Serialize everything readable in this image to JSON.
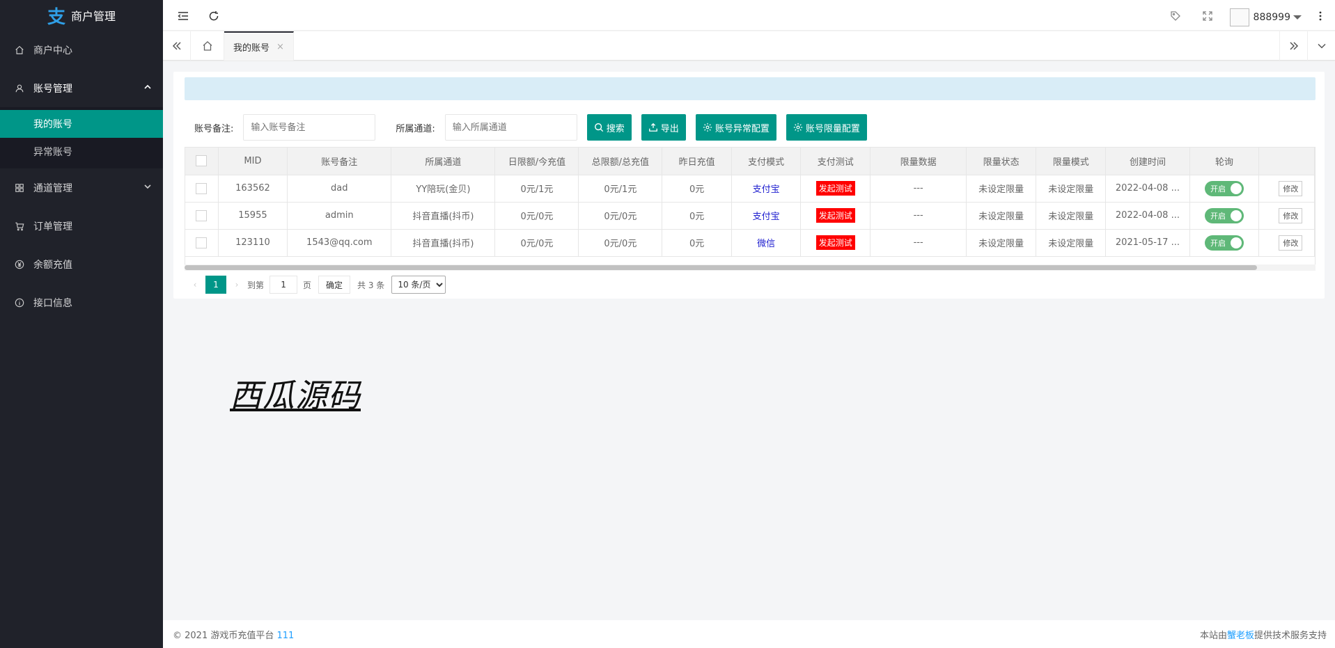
{
  "sidebar": {
    "logo_mark": "支",
    "title": "商户管理",
    "items": [
      {
        "label": "商户中心"
      },
      {
        "label": "账号管理",
        "children": [
          {
            "label": "我的账号"
          },
          {
            "label": "异常账号"
          }
        ]
      },
      {
        "label": "通道管理"
      },
      {
        "label": "订单管理"
      },
      {
        "label": "余额充值"
      },
      {
        "label": "接口信息"
      }
    ]
  },
  "header": {
    "username": "888999"
  },
  "tabs": [
    {
      "label": "我的账号",
      "close": "×"
    }
  ],
  "filter": {
    "remark_label": "账号备注:",
    "remark_placeholder": "输入账号备注",
    "channel_label": "所属通道:",
    "channel_placeholder": "输入所属通道",
    "search_btn": "搜索",
    "export_btn": "导出",
    "abnormal_btn": "账号异常配置",
    "limit_btn": "账号限量配置"
  },
  "table": {
    "columns": [
      "MID",
      "账号备注",
      "所属通道",
      "日限额/今充值",
      "总限额/总充值",
      "昨日充值",
      "支付模式",
      "支付测试",
      "限量数据",
      "限量状态",
      "限量模式",
      "创建时间",
      "轮询",
      ""
    ],
    "rows": [
      {
        "mid": "163562",
        "remark": "dad",
        "channel": "YY陪玩(金贝)",
        "daily": "0元/1元",
        "total": "0元/1元",
        "yesterday": "0元",
        "pay_mode": "支付宝",
        "test": "发起测试",
        "limit_data": "---",
        "limit_status": "未设定限量",
        "limit_mode": "未设定限量",
        "created": "2022-04-08 ...",
        "poll": "开启",
        "edit": "修改"
      },
      {
        "mid": "15955",
        "remark": "admin",
        "channel": "抖音直播(抖币)",
        "daily": "0元/0元",
        "total": "0元/0元",
        "yesterday": "0元",
        "pay_mode": "支付宝",
        "test": "发起测试",
        "limit_data": "---",
        "limit_status": "未设定限量",
        "limit_mode": "未设定限量",
        "created": "2022-04-08 ...",
        "poll": "开启",
        "edit": "修改"
      },
      {
        "mid": "123110",
        "remark": "1543@qq.com",
        "channel": "抖音直播(抖币)",
        "daily": "0元/0元",
        "total": "0元/0元",
        "yesterday": "0元",
        "pay_mode": "微信",
        "test": "发起测试",
        "limit_data": "---",
        "limit_status": "未设定限量",
        "limit_mode": "未设定限量",
        "created": "2021-05-17 ...",
        "poll": "开启",
        "edit": "修改"
      }
    ]
  },
  "pager": {
    "current": "1",
    "goto_label": "到第",
    "goto_value": "1",
    "page_unit": "页",
    "confirm": "确定",
    "total": "共 3 条",
    "page_size": "10 条/页"
  },
  "watermark": "西瓜源码",
  "footer": {
    "left_prefix": "© 2021 游戏币充值平台",
    "left_link": "111",
    "right_prefix": "本站由",
    "right_link": "蟹老板",
    "right_suffix": "提供技术服务支持"
  },
  "colors": {
    "accent": "#009688",
    "sidebar_bg": "#20222a",
    "danger": "#ff0000",
    "switch_on": "#5fb878",
    "link": "#1e9fff"
  }
}
